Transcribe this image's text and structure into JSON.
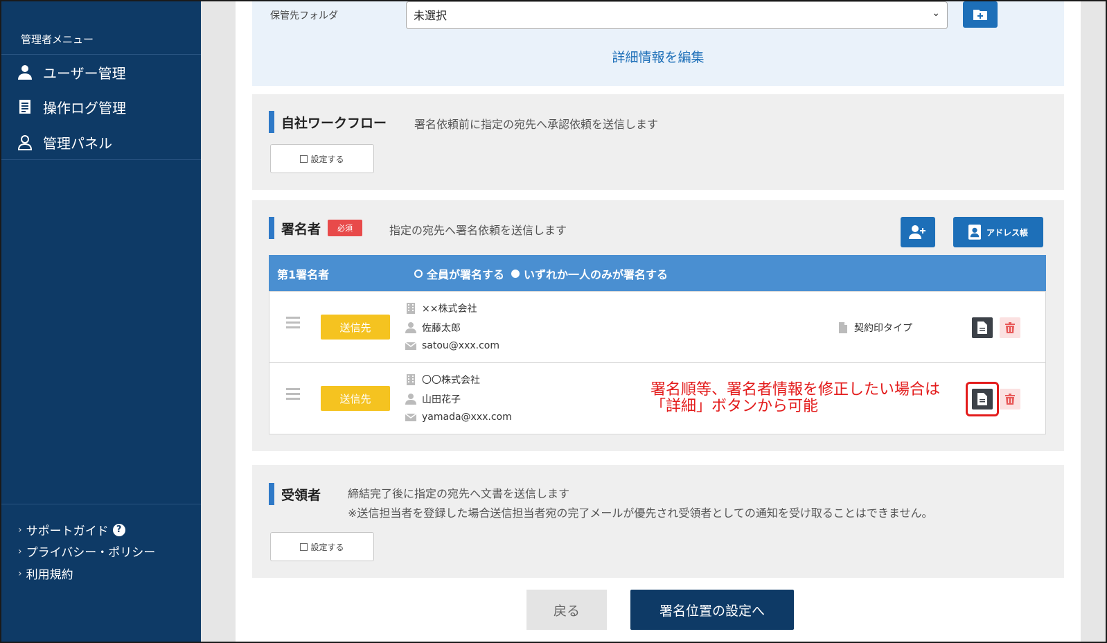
{
  "sidebar": {
    "menu_title": "管理者メニュー",
    "items": [
      {
        "label": "ユーザー管理",
        "icon": "user-icon"
      },
      {
        "label": "操作ログ管理",
        "icon": "log-icon"
      },
      {
        "label": "管理パネル",
        "icon": "admin-icon"
      }
    ],
    "footer": {
      "support": "サポートガイド",
      "privacy": "プライバシー・ポリシー",
      "terms": "利用規約"
    }
  },
  "storage": {
    "label": "保管先フォルダ",
    "value": "未選択",
    "edit_details": "詳細情報を編集"
  },
  "workflow": {
    "title": "自社ワークフロー",
    "desc": "署名依頼前に指定の宛先へ承認依頼を送信します",
    "setting": "設定する"
  },
  "signers": {
    "title": "署名者",
    "required": "必須",
    "desc": "指定の宛先へ署名依頼を送信します",
    "address_book": "アドレス帳",
    "group_label": "第1署名者",
    "option_all": "全員が署名する",
    "option_one": "いずれか一人のみが署名する",
    "rows": [
      {
        "role": "送信先",
        "company": "××株式会社",
        "name": "佐藤太郎",
        "email": "satou@xxx.com",
        "seal_type": "契約印タイプ"
      },
      {
        "role": "送信先",
        "company": "〇〇株式会社",
        "name": "山田花子",
        "email": "yamada@xxx.com"
      }
    ],
    "annotation_line1": "署名順等、署名者情報を修正したい場合は",
    "annotation_line2": "「詳細」ボタンから可能"
  },
  "recipients": {
    "title": "受領者",
    "desc1": "締結完了後に指定の宛先へ文書を送信します",
    "desc2": "※送信担当者を登録した場合送信担当者宛の完了メールが優先され受領者としての通知を受け取ることはできません。",
    "setting": "設定する"
  },
  "footer_buttons": {
    "back": "戻る",
    "next": "署名位置の設定へ"
  },
  "colors": {
    "sidebar": "#0e3a66",
    "accent": "#1d6fb8",
    "table_header": "#4a8fd1",
    "yellow": "#f5c320",
    "annotation": "#e31c1c"
  }
}
